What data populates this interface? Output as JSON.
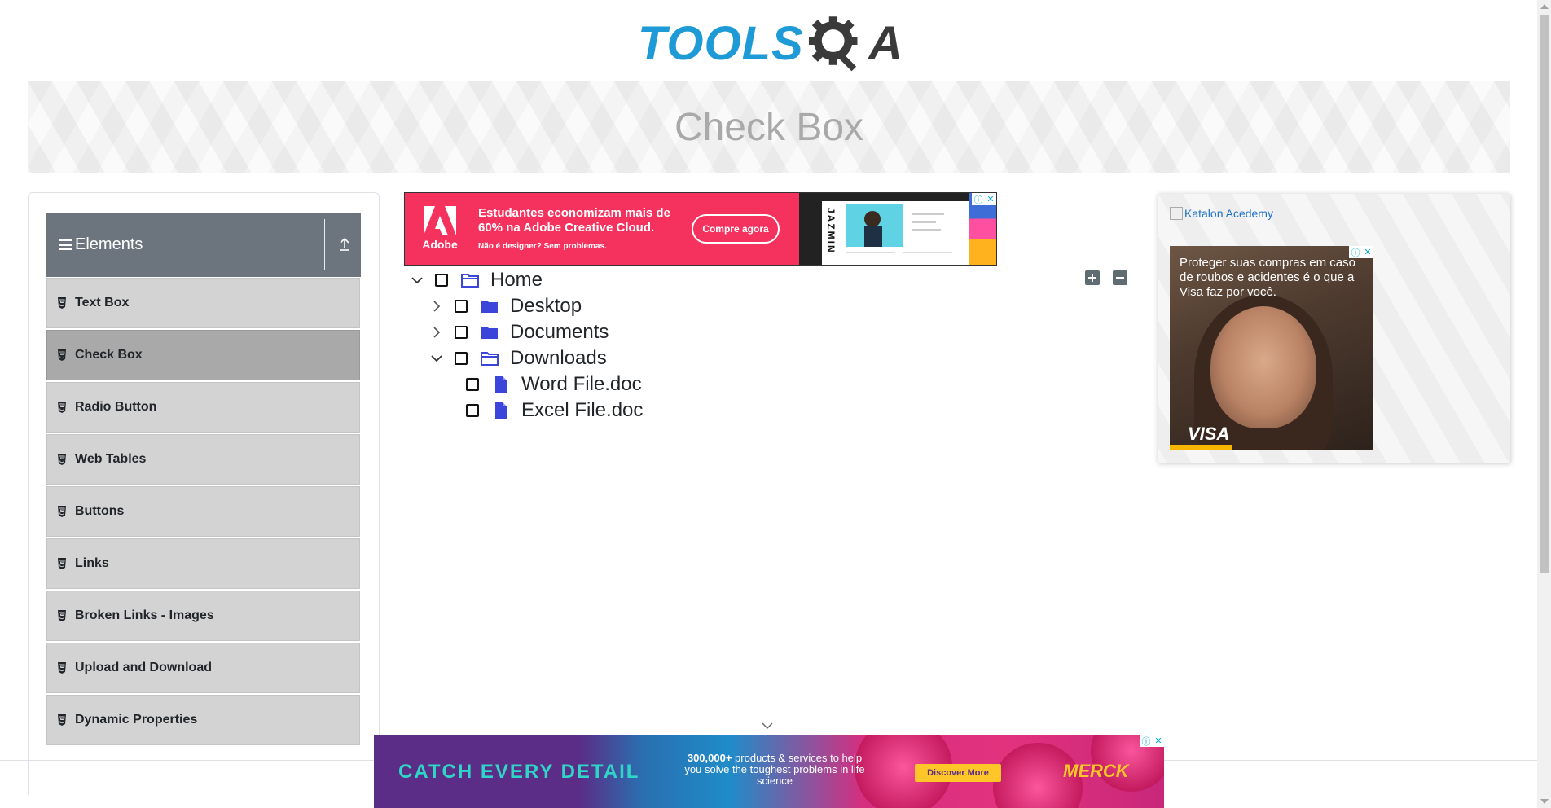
{
  "header": {
    "logo_text_left": "TOOLS",
    "logo_text_right": "A"
  },
  "banner": {
    "title": "Check Box"
  },
  "sidebar": {
    "group_title": "Elements",
    "items": [
      {
        "label": "Text Box"
      },
      {
        "label": "Check Box",
        "active": true
      },
      {
        "label": "Radio Button"
      },
      {
        "label": "Web Tables"
      },
      {
        "label": "Buttons"
      },
      {
        "label": "Links"
      },
      {
        "label": "Broken Links - Images"
      },
      {
        "label": "Upload and Download"
      },
      {
        "label": "Dynamic Properties"
      }
    ]
  },
  "ad_top": {
    "brand": "Adobe",
    "headline": "Estudantes economizam mais de 60% na Adobe Creative Cloud.",
    "sub": "Não é designer? Sem problemas.",
    "cta": "Compre agora",
    "product": "JAZMIN",
    "accent": "#f5325e"
  },
  "tree": {
    "nodes": [
      {
        "label": "Home",
        "expanded": true,
        "checked": false,
        "type": "folder-open"
      },
      {
        "label": "Desktop",
        "expanded": false,
        "checked": false,
        "type": "folder"
      },
      {
        "label": "Documents",
        "expanded": false,
        "checked": false,
        "type": "folder"
      },
      {
        "label": "Downloads",
        "expanded": true,
        "checked": false,
        "type": "folder-open"
      },
      {
        "label": "Word File.doc",
        "checked": false,
        "type": "file"
      },
      {
        "label": "Excel File.doc",
        "checked": false,
        "type": "file"
      }
    ],
    "expand_all_icon": "plus-square-icon",
    "collapse_all_icon": "minus-square-icon"
  },
  "right_ad": {
    "link_text": "Katalon Acedemy",
    "visa_copy": "Proteger suas compras em caso de roubos e acidentes é o que a Visa faz por você.",
    "visa_brand": "VISA"
  },
  "ad_bottom": {
    "headline": "CATCH EVERY DETAIL",
    "blurb_bold": "300,000+",
    "blurb": " products & services to help you solve the toughest problems in life science",
    "cta": "Discover More",
    "brand": "MERCK"
  },
  "colors": {
    "logo_blue": "#1e9ad6",
    "folder_blue": "#3b45d9",
    "sidebar_header": "#6c757d",
    "menu_item": "#d3d3d3",
    "menu_active": "#a9a9a9"
  }
}
